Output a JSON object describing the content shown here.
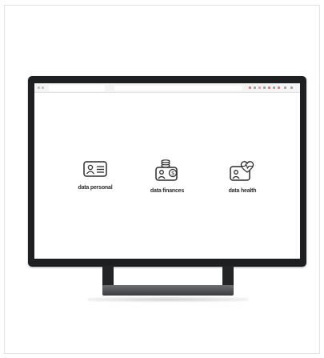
{
  "screen": {
    "items": [
      {
        "label": "data personal",
        "icon": "id-card-icon"
      },
      {
        "label": "data finances",
        "icon": "coins-card-icon"
      },
      {
        "label": "data health",
        "icon": "heart-pulse-card-icon"
      }
    ]
  },
  "colors": {
    "monitor": "#1e1f21",
    "screen": "#ffffff",
    "icon_stroke": "#2c2c2c",
    "label": "#2c2c2c"
  }
}
